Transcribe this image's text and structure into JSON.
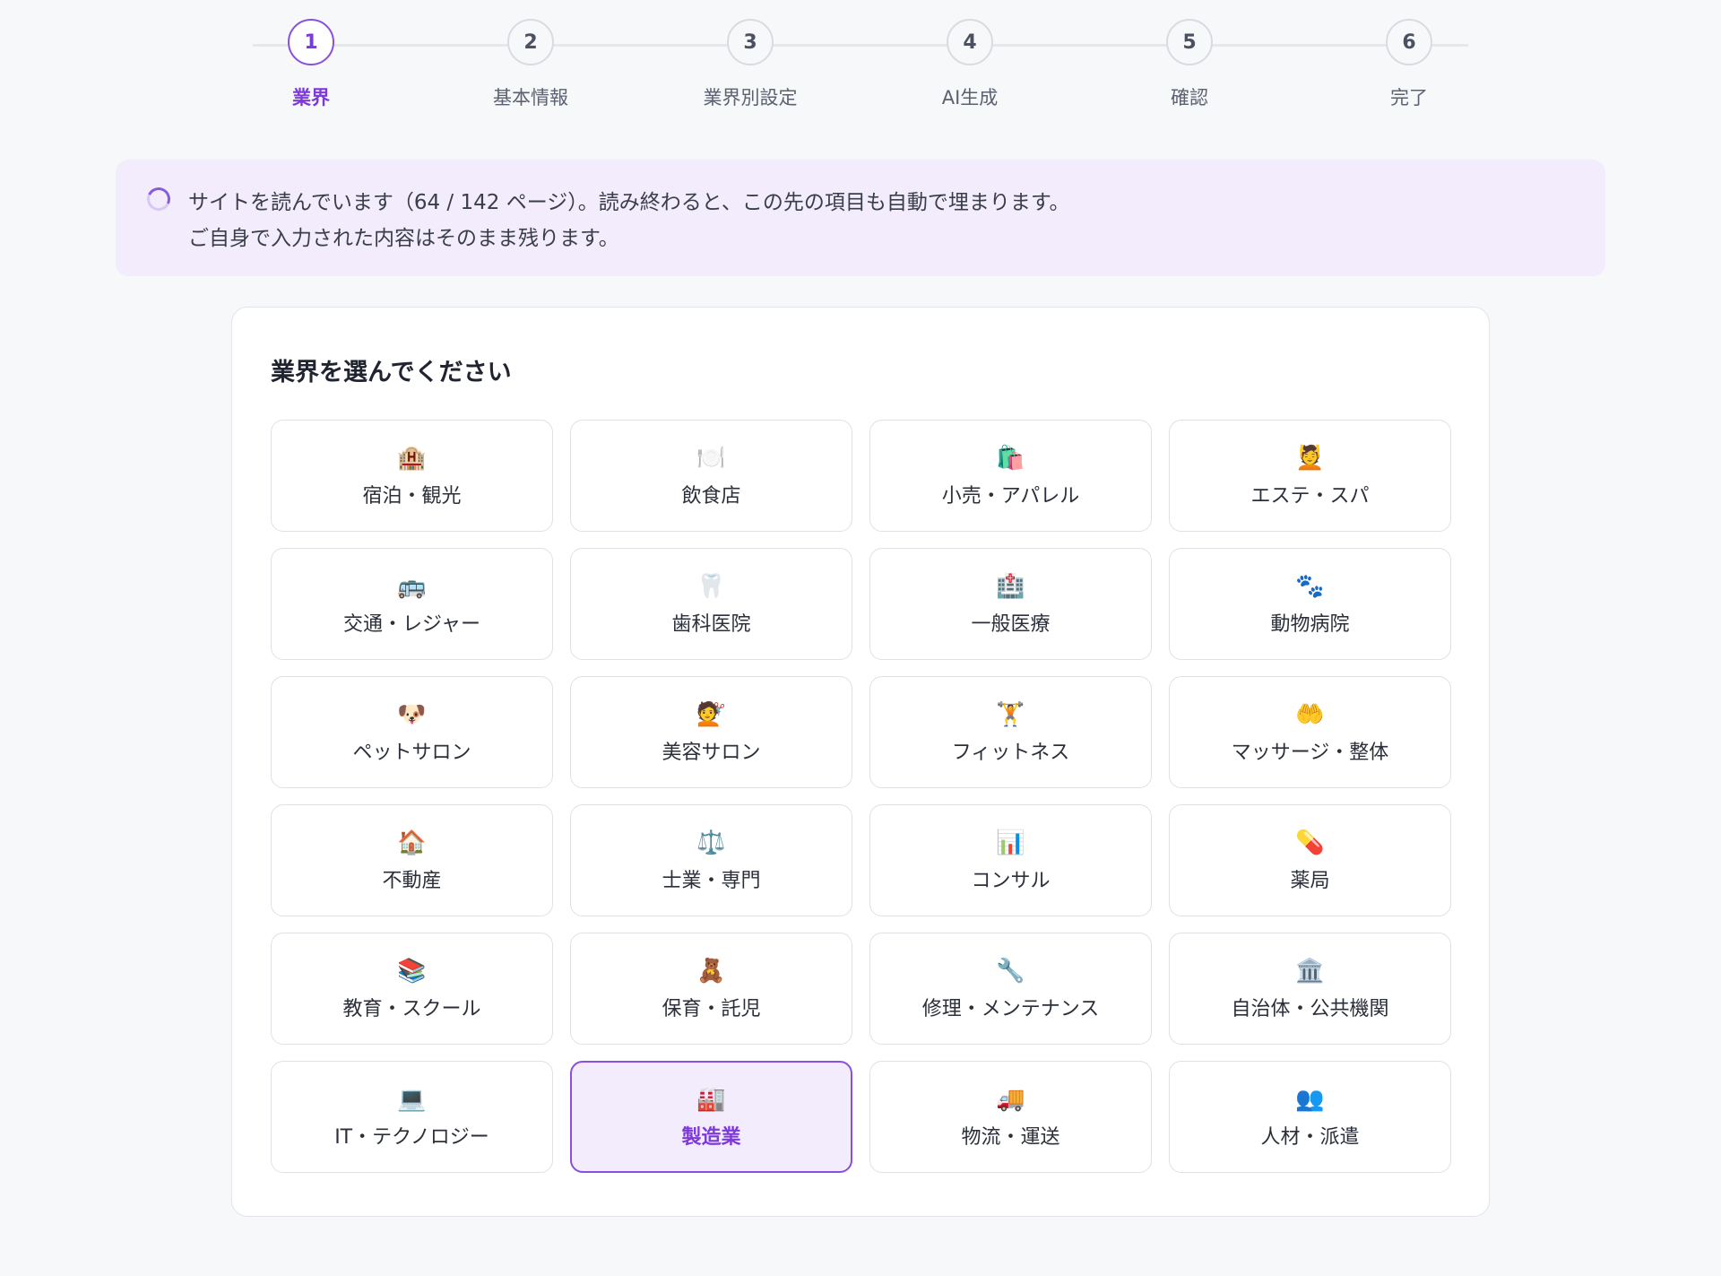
{
  "colors": {
    "accent": "#7d3ad8",
    "notice_bg": "#f2ecfd",
    "selected_bg": "#f3ecfd"
  },
  "stepper": {
    "active_step": 1,
    "steps": [
      {
        "number": "1",
        "label": "業界"
      },
      {
        "number": "2",
        "label": "基本情報"
      },
      {
        "number": "3",
        "label": "業界別設定"
      },
      {
        "number": "4",
        "label": "AI生成"
      },
      {
        "number": "5",
        "label": "確認"
      },
      {
        "number": "6",
        "label": "完了"
      }
    ]
  },
  "notice": {
    "icon": "loading-spinner-icon",
    "line1": "サイトを読んでいます（64 / 142 ページ）。読み終わると、この先の項目も自動で埋まります。",
    "line2": "ご自身で入力された内容はそのまま残ります。"
  },
  "industry_select": {
    "title": "業界を選んでください",
    "selected": "製造業",
    "options": [
      {
        "icon": "hotel-icon",
        "glyph": "🏨",
        "label": "宿泊・観光"
      },
      {
        "icon": "plate-icon",
        "glyph": "🍽️",
        "label": "飲食店"
      },
      {
        "icon": "shopping-bag-icon",
        "glyph": "🛍️",
        "label": "小売・アパレル"
      },
      {
        "icon": "massage-face-icon",
        "glyph": "💆",
        "label": "エステ・スパ"
      },
      {
        "icon": "bus-icon",
        "glyph": "🚌",
        "label": "交通・レジャー"
      },
      {
        "icon": "tooth-icon",
        "glyph": "🦷",
        "label": "歯科医院"
      },
      {
        "icon": "hospital-icon",
        "glyph": "🏥",
        "label": "一般医療"
      },
      {
        "icon": "paw-icon",
        "glyph": "🐾",
        "label": "動物病院"
      },
      {
        "icon": "dog-icon",
        "glyph": "🐶",
        "label": "ペットサロン"
      },
      {
        "icon": "haircut-icon",
        "glyph": "💇",
        "label": "美容サロン"
      },
      {
        "icon": "weightlifter-icon",
        "glyph": "🏋️",
        "label": "フィットネス"
      },
      {
        "icon": "open-hands-icon",
        "glyph": "🤲",
        "label": "マッサージ・整体"
      },
      {
        "icon": "house-icon",
        "glyph": "🏠",
        "label": "不動産"
      },
      {
        "icon": "scales-icon",
        "glyph": "⚖️",
        "label": "士業・専門"
      },
      {
        "icon": "bar-chart-icon",
        "glyph": "📊",
        "label": "コンサル"
      },
      {
        "icon": "pill-icon",
        "glyph": "💊",
        "label": "薬局"
      },
      {
        "icon": "books-icon",
        "glyph": "📚",
        "label": "教育・スクール"
      },
      {
        "icon": "teddy-bear-icon",
        "glyph": "🧸",
        "label": "保育・託児"
      },
      {
        "icon": "wrench-icon",
        "glyph": "🔧",
        "label": "修理・メンテナンス"
      },
      {
        "icon": "government-building-icon",
        "glyph": "🏛️",
        "label": "自治体・公共機関"
      },
      {
        "icon": "laptop-icon",
        "glyph": "💻",
        "label": "IT・テクノロジー"
      },
      {
        "icon": "factory-icon",
        "glyph": "🏭",
        "label": "製造業"
      },
      {
        "icon": "delivery-truck-icon",
        "glyph": "🚚",
        "label": "物流・運送"
      },
      {
        "icon": "people-icon",
        "glyph": "👥",
        "label": "人材・派遣"
      }
    ]
  }
}
